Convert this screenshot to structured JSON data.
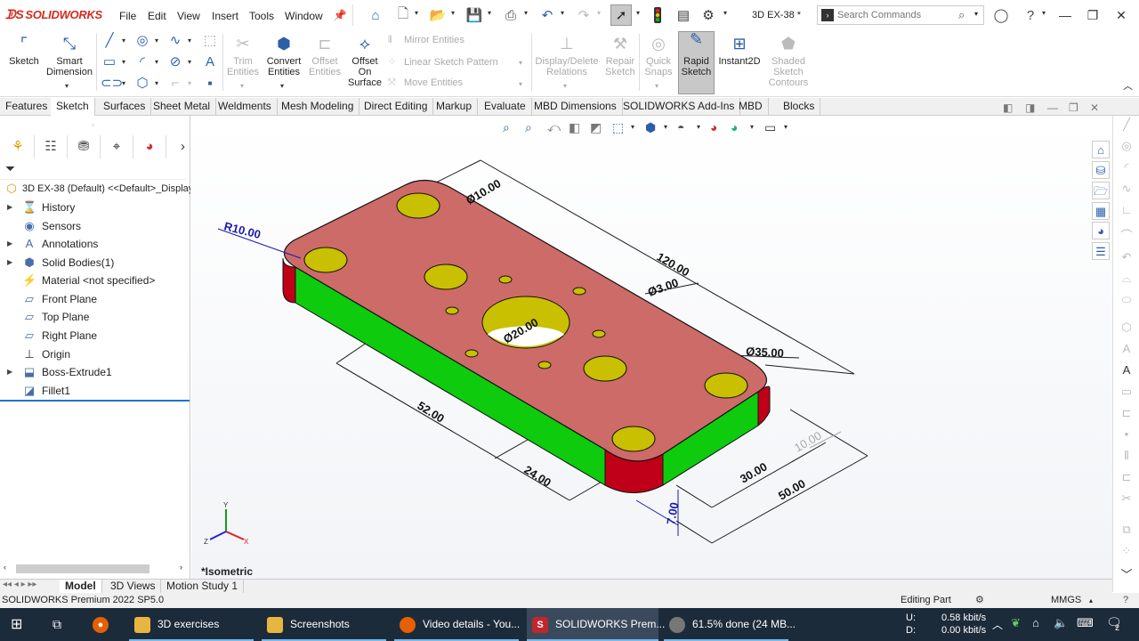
{
  "app": {
    "logo_text": "SOLIDWORKS",
    "document_title": "3D EX-38 *",
    "menus": [
      "File",
      "Edit",
      "View",
      "Insert",
      "Tools",
      "Window"
    ],
    "search_placeholder": "Search Commands"
  },
  "commands": {
    "sketch": "Sketch",
    "smart_dimension": [
      "Smart",
      "Dimension"
    ],
    "trim_entities": [
      "Trim",
      "Entities"
    ],
    "convert_entities": [
      "Convert",
      "Entities"
    ],
    "offset_entities": [
      "Offset",
      "Entities"
    ],
    "offset_on_surface": [
      "Offset",
      "On",
      "Surface"
    ],
    "mirror_entities": "Mirror Entities",
    "linear_sketch_pattern": "Linear Sketch Pattern",
    "move_entities": "Move Entities",
    "display_delete_relations": [
      "Display/Delete",
      "Relations"
    ],
    "repair_sketch": [
      "Repair",
      "Sketch"
    ],
    "quick_snaps": [
      "Quick",
      "Snaps"
    ],
    "rapid_sketch": [
      "Rapid",
      "Sketch"
    ],
    "instant2d": "Instant2D",
    "shaded_sketch_contours": [
      "Shaded",
      "Sketch",
      "Contours"
    ]
  },
  "tabs": [
    {
      "label": "Features",
      "active": false
    },
    {
      "label": "Sketch",
      "active": true
    },
    {
      "label": "Surfaces",
      "active": false
    },
    {
      "label": "Sheet Metal",
      "active": false
    },
    {
      "label": "Weldments",
      "active": false
    },
    {
      "label": "Mesh Modeling",
      "active": false
    },
    {
      "label": "Direct Editing",
      "active": false
    },
    {
      "label": "Markup",
      "active": false
    },
    {
      "label": "Evaluate",
      "active": false
    },
    {
      "label": "MBD Dimensions",
      "active": false
    },
    {
      "label": "SOLIDWORKS Add-Ins",
      "active": false
    },
    {
      "label": "MBD",
      "active": false
    },
    {
      "label": "Blocks",
      "active": false
    }
  ],
  "tree": {
    "root": "3D EX-38 (Default) <<Default>_Display",
    "items": [
      {
        "label": "History",
        "icon": "history-icon",
        "expandable": true
      },
      {
        "label": "Sensors",
        "icon": "sensors-icon",
        "expandable": false
      },
      {
        "label": "Annotations",
        "icon": "annotations-icon",
        "expandable": true
      },
      {
        "label": "Solid Bodies(1)",
        "icon": "solid-bodies-icon",
        "expandable": true
      },
      {
        "label": "Material <not specified>",
        "icon": "material-icon",
        "expandable": false
      },
      {
        "label": "Front Plane",
        "icon": "plane-icon",
        "expandable": false
      },
      {
        "label": "Top Plane",
        "icon": "plane-icon",
        "expandable": false
      },
      {
        "label": "Right Plane",
        "icon": "plane-icon",
        "expandable": false
      },
      {
        "label": "Origin",
        "icon": "origin-icon",
        "expandable": false
      },
      {
        "label": "Boss-Extrude1",
        "icon": "extrude-icon",
        "expandable": true
      },
      {
        "label": "Fillet1",
        "icon": "fillet-icon",
        "expandable": false
      }
    ]
  },
  "viewport": {
    "view_label": "*Isometric",
    "dimensions": {
      "hole_small": "Ø10.00",
      "radius": "R10.00",
      "length": "120.00",
      "hole_tiny": "Ø3.00",
      "hole_center": "Ø20.00",
      "hole_big_ref": "Ø35.00",
      "dim_52": "52.00",
      "dim_24": "24.00",
      "dim_10": "10.00",
      "dim_30": "30.00",
      "dim_50": "50.00",
      "dim_7": "7.00"
    },
    "axis_labels": {
      "x": "X",
      "y": "Y",
      "z": "Z"
    }
  },
  "bottom_tabs": [
    {
      "label": "Model",
      "active": true
    },
    {
      "label": "3D Views",
      "active": false
    },
    {
      "label": "Motion Study 1",
      "active": false
    }
  ],
  "status": {
    "product": "SOLIDWORKS Premium 2022 SP5.0",
    "mode": "Editing Part",
    "units": "MMGS"
  },
  "taskbar": {
    "items": [
      {
        "label": "3D exercises",
        "icon": "folder-icon"
      },
      {
        "label": "Screenshots",
        "icon": "folder-icon"
      },
      {
        "label": "Video details - You...",
        "icon": "firefox-icon"
      },
      {
        "label": "SOLIDWORKS Prem...",
        "icon": "solidworks-icon"
      },
      {
        "label": "61.5% done (24 MB...",
        "icon": "download-icon"
      }
    ],
    "net_up_label": "U:",
    "net_up": "0.58 kbit/s",
    "net_down_label": "D:",
    "net_down": "0.00 kbit/s",
    "notification_count": "2"
  },
  "colors": {
    "top_face": "#cd6b69",
    "side_green": "#0ecb0e",
    "side_red": "#c00018",
    "hole_yellow": "#c8c000",
    "dimension_line": "#1a1a1a",
    "selected_dimension": "#1a1aa8"
  }
}
